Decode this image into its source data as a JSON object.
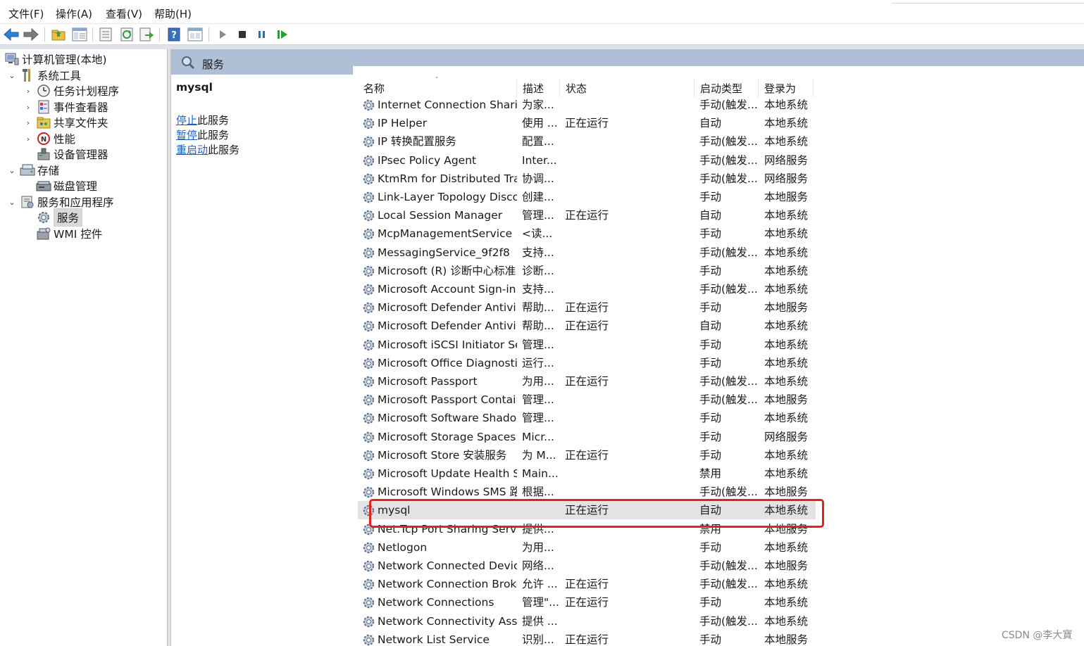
{
  "menu": {
    "file": "文件(F)",
    "action": "操作(A)",
    "view": "查看(V)",
    "help": "帮助(H)"
  },
  "toolbar_icons": [
    "back-arrow-icon",
    "forward-arrow-icon",
    "up-folder-icon",
    "show-hide-tree-icon",
    "properties-icon",
    "refresh-icon",
    "export-list-icon",
    "help-icon",
    "console-view-icon",
    "start-service-icon",
    "stop-service-icon",
    "pause-service-icon",
    "restart-service-icon"
  ],
  "tree": {
    "root": "计算机管理(本地)",
    "system_tools": "系统工具",
    "task_scheduler": "任务计划程序",
    "event_viewer": "事件查看器",
    "shared_folders": "共享文件夹",
    "performance": "性能",
    "device_manager": "设备管理器",
    "storage": "存储",
    "disk_management": "磁盘管理",
    "services_apps": "服务和应用程序",
    "services": "服务",
    "wmi": "WMI 控件"
  },
  "header": {
    "title": "服务"
  },
  "ext": {
    "service_name": "mysql",
    "stop_link": "停止",
    "stop_suffix": "此服务",
    "pause_link": "暂停",
    "pause_suffix": "此服务",
    "restart_link": "重启动",
    "restart_suffix": "此服务"
  },
  "columns": {
    "name": "名称",
    "desc": "描述",
    "status": "状态",
    "startup": "启动类型",
    "logon": "登录为"
  },
  "rows": [
    [
      "Internet Connection Sharin...",
      "为家...",
      "",
      "手动(触发...",
      "本地系统"
    ],
    [
      "IP Helper",
      "使用 ...",
      "正在运行",
      "自动",
      "本地系统"
    ],
    [
      "IP 转换配置服务",
      "配置...",
      "",
      "手动(触发...",
      "本地系统"
    ],
    [
      "IPsec Policy Agent",
      "Inter...",
      "",
      "手动(触发...",
      "网络服务"
    ],
    [
      "KtmRm for Distributed Tra...",
      "协调...",
      "",
      "手动(触发...",
      "网络服务"
    ],
    [
      "Link-Layer Topology Disco...",
      "创建...",
      "",
      "手动",
      "本地服务"
    ],
    [
      "Local Session Manager",
      "管理...",
      "正在运行",
      "自动",
      "本地系统"
    ],
    [
      "McpManagementService",
      "<读...",
      "",
      "手动",
      "本地系统"
    ],
    [
      "MessagingService_9f2f8",
      "支持...",
      "",
      "手动(触发...",
      "本地系统"
    ],
    [
      "Microsoft (R) 诊断中心标准...",
      "诊断...",
      "",
      "手动",
      "本地系统"
    ],
    [
      "Microsoft Account Sign-in ...",
      "支持...",
      "",
      "手动(触发...",
      "本地系统"
    ],
    [
      "Microsoft Defender Antivir...",
      "帮助...",
      "正在运行",
      "手动",
      "本地服务"
    ],
    [
      "Microsoft Defender Antivir...",
      "帮助...",
      "正在运行",
      "自动",
      "本地系统"
    ],
    [
      "Microsoft iSCSI Initiator Ser...",
      "管理...",
      "",
      "手动",
      "本地系统"
    ],
    [
      "Microsoft Office Diagnosti...",
      "运行...",
      "",
      "手动",
      "本地系统"
    ],
    [
      "Microsoft Passport",
      "为用...",
      "正在运行",
      "手动(触发...",
      "本地系统"
    ],
    [
      "Microsoft Passport Container",
      "管理...",
      "",
      "手动(触发...",
      "本地服务"
    ],
    [
      "Microsoft Software Shado...",
      "管理...",
      "",
      "手动",
      "本地系统"
    ],
    [
      "Microsoft Storage Spaces S...",
      "Micr...",
      "",
      "手动",
      "网络服务"
    ],
    [
      "Microsoft Store 安装服务",
      "为 M...",
      "正在运行",
      "手动",
      "本地系统"
    ],
    [
      "Microsoft Update Health S...",
      "Main...",
      "",
      "禁用",
      "本地系统"
    ],
    [
      "Microsoft Windows SMS 路...",
      "根据...",
      "",
      "手动(触发...",
      "本地服务"
    ],
    [
      "mysql",
      "",
      "正在运行",
      "自动",
      "本地系统"
    ],
    [
      "Net.Tcp Port Sharing Service",
      "提供...",
      "",
      "禁用",
      "本地服务"
    ],
    [
      "Netlogon",
      "为用...",
      "",
      "手动",
      "本地系统"
    ],
    [
      "Network Connected Devic...",
      "网络...",
      "",
      "手动(触发...",
      "本地服务"
    ],
    [
      "Network Connection Broker",
      "允许 ...",
      "正在运行",
      "手动(触发...",
      "本地系统"
    ],
    [
      "Network Connections",
      "管理\"...",
      "正在运行",
      "手动",
      "本地系统"
    ],
    [
      "Network Connectivity Assis...",
      "提供 ...",
      "",
      "手动(触发...",
      "本地系统"
    ],
    [
      "Network List Service",
      "识别...",
      "正在运行",
      "手动",
      "本地服务"
    ]
  ],
  "selected_row": 22,
  "watermark": "CSDN @李大寶",
  "colors": {
    "header_band": "#aebfd6",
    "link": "#1f5fc4",
    "highlight_border": "#e52020"
  }
}
